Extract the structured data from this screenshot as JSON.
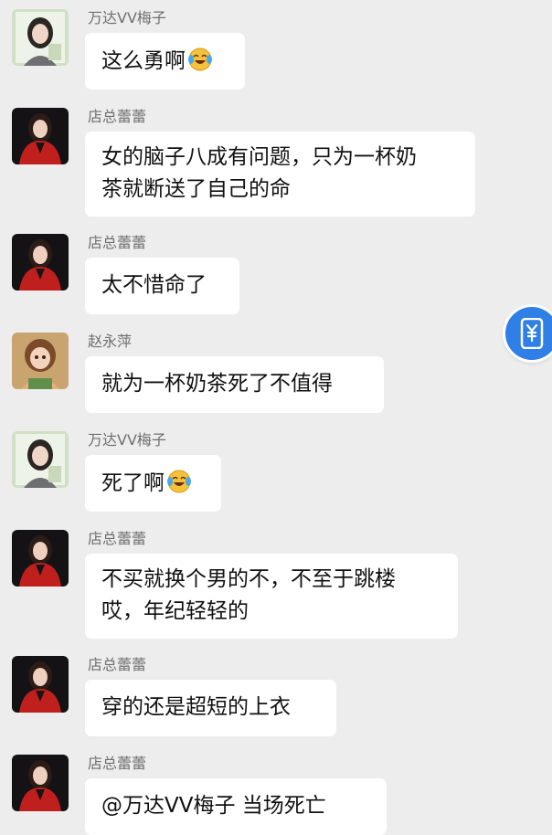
{
  "messages": [
    {
      "sender": "万达VV梅子",
      "avatar": "woman-portrait-light-frame",
      "lines": [
        "这么勇啊"
      ],
      "emoji": "laugh-cry-emoji"
    },
    {
      "sender": "店总蕾蕾",
      "avatar": "woman-red-jacket-portrait",
      "lines": [
        "女的脑子八成有问题，只为一杯奶",
        "茶就断送了自己的命"
      ]
    },
    {
      "sender": "店总蕾蕾",
      "avatar": "woman-red-jacket-portrait",
      "lines": [
        "太不惜命了"
      ]
    },
    {
      "sender": "赵永萍",
      "avatar": "cartoon-girl-portrait",
      "lines": [
        "就为一杯奶茶死了不值得"
      ]
    },
    {
      "sender": "万达VV梅子",
      "avatar": "woman-portrait-light-frame",
      "lines": [
        "死了啊"
      ],
      "emoji": "laugh-cry-emoji"
    },
    {
      "sender": "店总蕾蕾",
      "avatar": "woman-red-jacket-portrait",
      "lines": [
        "不买就换个男的不，不至于跳楼",
        "哎，年纪轻轻的"
      ]
    },
    {
      "sender": "店总蕾蕾",
      "avatar": "woman-red-jacket-portrait",
      "lines": [
        "穿的还是超短的上衣"
      ]
    },
    {
      "sender": "店总蕾蕾",
      "avatar": "woman-red-jacket-portrait",
      "lines": [
        "@万达VV梅子  当场死亡"
      ]
    }
  ],
  "floating_button": {
    "icon": "phone-yuan-icon",
    "color": "#2f7fe6"
  }
}
